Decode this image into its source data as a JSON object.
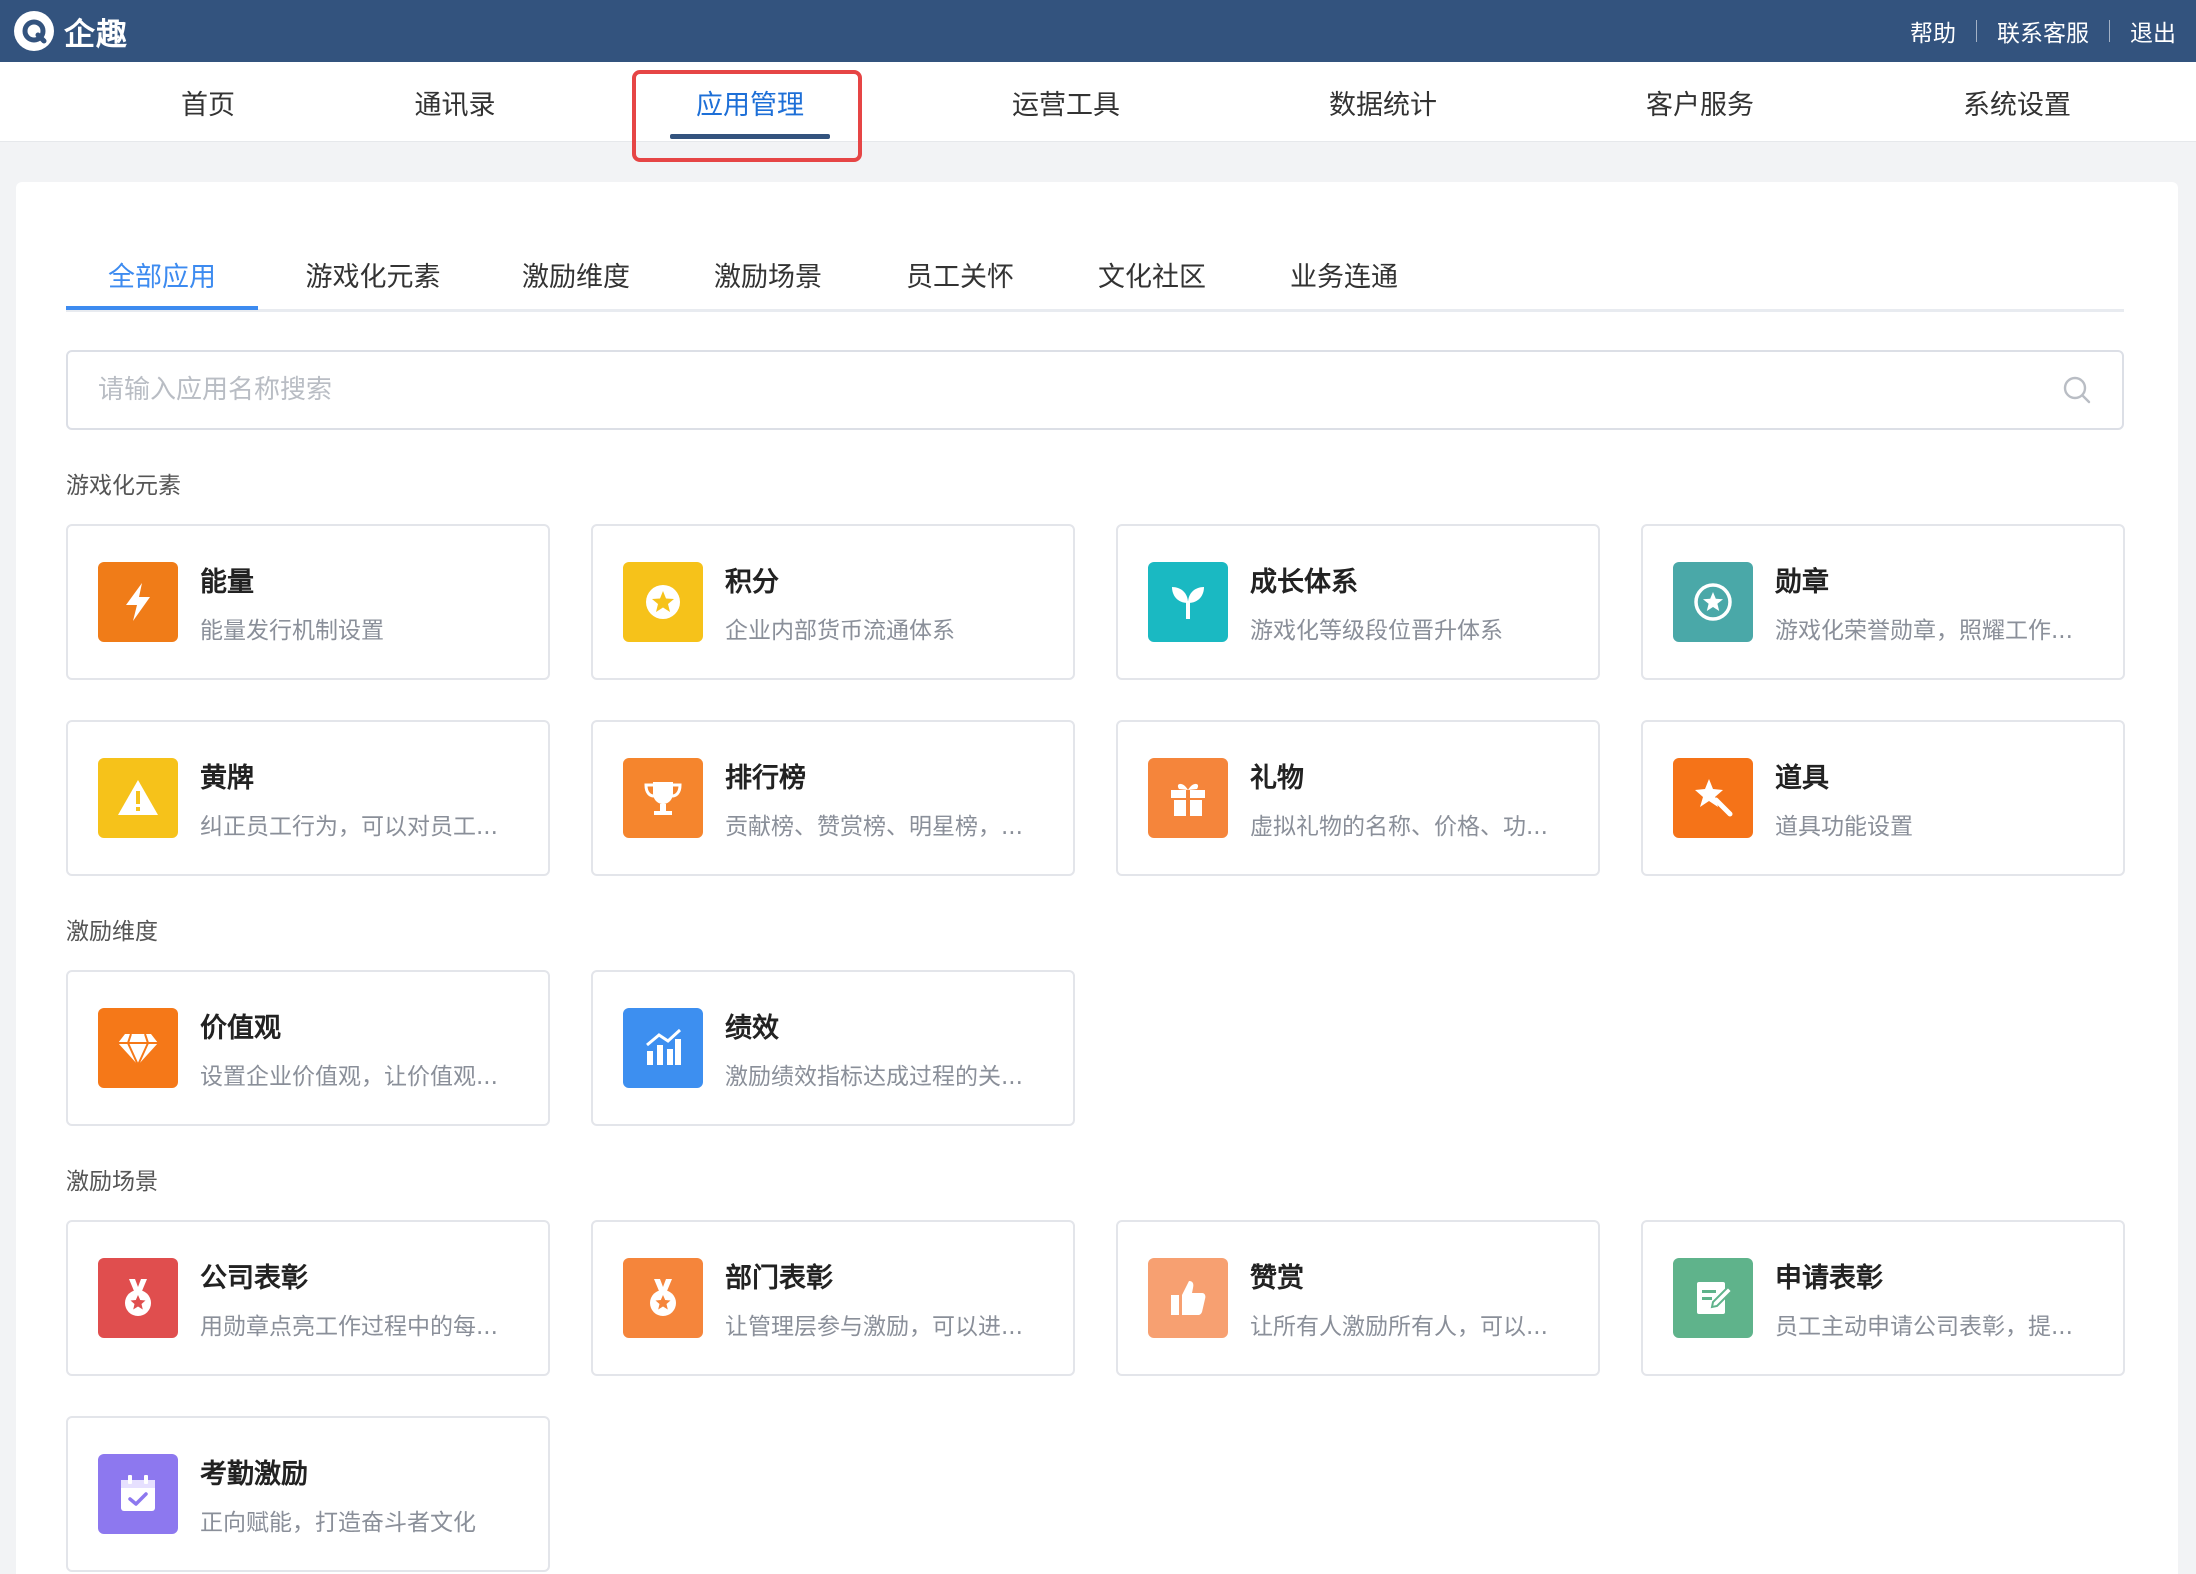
{
  "brand": {
    "name": "企趣"
  },
  "top_links": [
    "帮助",
    "联系客服",
    "退出"
  ],
  "nav": [
    "首页",
    "通讯录",
    "应用管理",
    "运营工具",
    "数据统计",
    "客户服务",
    "系统设置"
  ],
  "subtabs": [
    "全部应用",
    "游戏化元素",
    "激励维度",
    "激励场景",
    "员工关怀",
    "文化社区",
    "业务连通"
  ],
  "search": {
    "placeholder": "请输入应用名称搜索"
  },
  "sections": {
    "gamification": {
      "title": "游戏化元素",
      "cards": [
        {
          "title": "能量",
          "desc": "能量发行机制设置",
          "icon": "lightning-icon",
          "color": "#f07c18"
        },
        {
          "title": "积分",
          "desc": "企业内部货币流通体系",
          "icon": "star-coin-icon",
          "color": "#f6c21a"
        },
        {
          "title": "成长体系",
          "desc": "游戏化等级段位晋升体系",
          "icon": "sprout-icon",
          "color": "#1ab9c2"
        },
        {
          "title": "勋章",
          "desc": "游戏化荣誉勋章，照耀工作...",
          "icon": "medal-star-icon",
          "color": "#4aa8a8"
        },
        {
          "title": "黄牌",
          "desc": "纠正员工行为，可以对员工...",
          "icon": "warning-icon",
          "color": "#f6c21a"
        },
        {
          "title": "排行榜",
          "desc": "贡献榜、赞赏榜、明星榜，...",
          "icon": "trophy-icon",
          "color": "#f5852d"
        },
        {
          "title": "礼物",
          "desc": "虚拟礼物的名称、价格、功...",
          "icon": "gift-icon",
          "color": "#f5853b"
        },
        {
          "title": "道具",
          "desc": "道具功能设置",
          "icon": "magic-wand-icon",
          "color": "#f57318"
        }
      ]
    },
    "dimension": {
      "title": "激励维度",
      "cards": [
        {
          "title": "价值观",
          "desc": "设置企业价值观，让价值观...",
          "icon": "diamond-icon",
          "color": "#f57818"
        },
        {
          "title": "绩效",
          "desc": "激励绩效指标达成过程的关...",
          "icon": "bar-chart-icon",
          "color": "#3d8ff0"
        }
      ]
    },
    "scene": {
      "title": "激励场景",
      "cards": [
        {
          "title": "公司表彰",
          "desc": "用勋章点亮工作过程中的每...",
          "icon": "award-ribbon-icon",
          "color": "#e04e4e"
        },
        {
          "title": "部门表彰",
          "desc": "让管理层参与激励，可以进...",
          "icon": "award-ribbon-icon",
          "color": "#f5853b"
        },
        {
          "title": "赞赏",
          "desc": "让所有人激励所有人，可以...",
          "icon": "thumbs-up-icon",
          "color": "#f7a071"
        },
        {
          "title": "申请表彰",
          "desc": "员工主动申请公司表彰，提...",
          "icon": "edit-doc-icon",
          "color": "#5fb38b"
        },
        {
          "title": "考勤激励",
          "desc": "正向赋能，打造奋斗者文化",
          "icon": "calendar-check-icon",
          "color": "#8d78ef"
        }
      ]
    }
  },
  "colors": {
    "topbar": "#33537e",
    "accent": "#3d8bf0",
    "highlight": "#e64545"
  }
}
